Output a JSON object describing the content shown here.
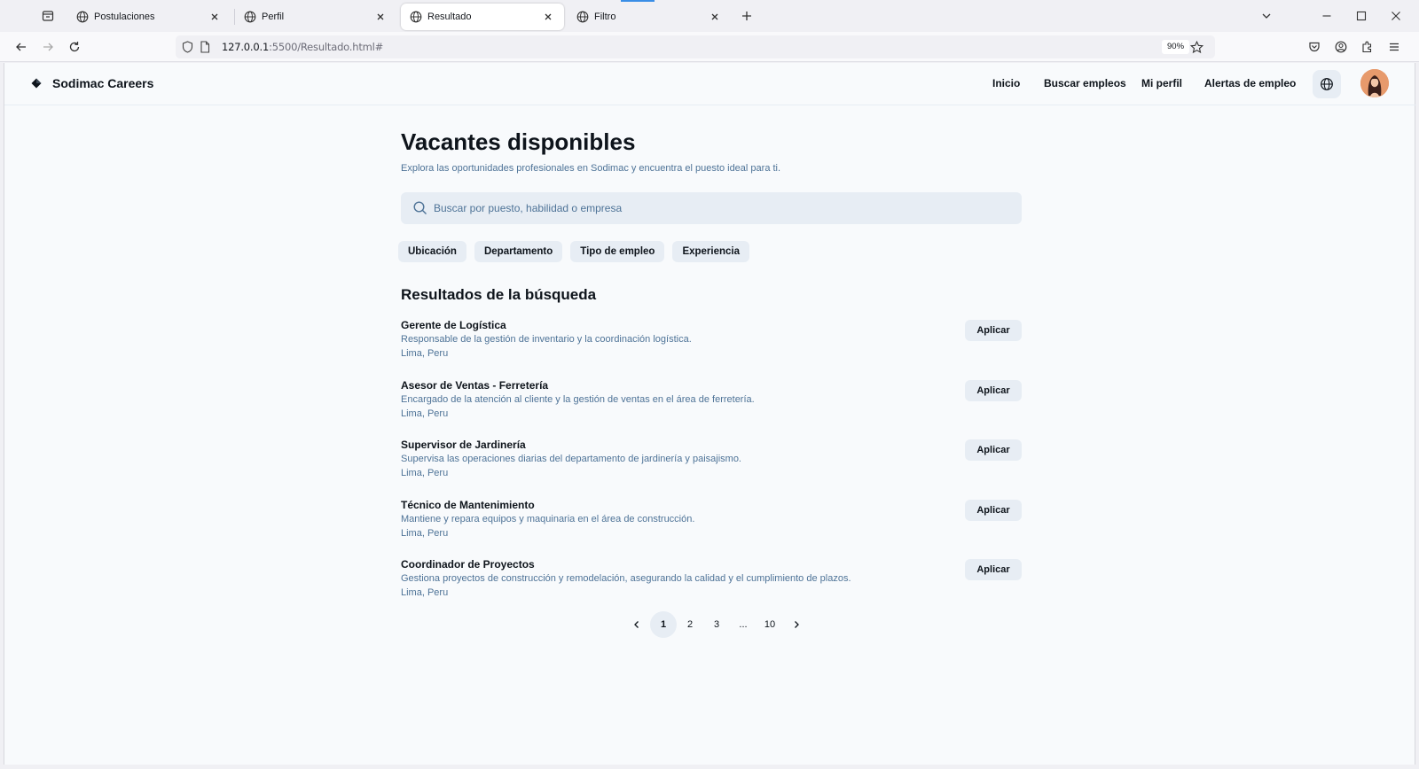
{
  "browser": {
    "tabs": [
      {
        "title": "Postulaciones",
        "active": false
      },
      {
        "title": "Perfil",
        "active": false
      },
      {
        "title": "Resultado",
        "active": true
      },
      {
        "title": "Filtro",
        "active": false
      }
    ],
    "url_host": "127.0.0.1",
    "url_rest": ":5500/Resultado.html#",
    "zoom": "90%"
  },
  "header": {
    "brand": "Sodimac Careers",
    "nav": [
      "Inicio",
      "Buscar empleos",
      "Mi perfil",
      "Alertas de empleo"
    ]
  },
  "main": {
    "title": "Vacantes disponibles",
    "subtitle": "Explora las oportunidades profesionales en Sodimac y encuentra el puesto ideal para ti.",
    "search_placeholder": "Buscar por puesto, habilidad o empresa",
    "filters": [
      "Ubicación",
      "Departamento",
      "Tipo de empleo",
      "Experiencia"
    ],
    "results_title": "Resultados de la búsqueda",
    "apply_label": "Aplicar",
    "results": [
      {
        "title": "Gerente de Logística",
        "description": "Responsable de la gestión de inventario y la coordinación logística.",
        "location": "Lima, Peru"
      },
      {
        "title": "Asesor de Ventas - Ferretería",
        "description": "Encargado de la atención al cliente y la gestión de ventas en el área de ferretería.",
        "location": "Lima, Peru"
      },
      {
        "title": "Supervisor de Jardinería",
        "description": "Supervisa las operaciones diarias del departamento de jardinería y paisajismo.",
        "location": "Lima, Peru"
      },
      {
        "title": "Técnico de Mantenimiento",
        "description": "Mantiene y repara equipos y maquinaria en el área de construcción.",
        "location": "Lima, Peru"
      },
      {
        "title": "Coordinador de Proyectos",
        "description": "Gestiona proyectos de construcción y remodelación, asegurando la calidad y el cumplimiento de plazos.",
        "location": "Lima, Peru"
      }
    ],
    "pagination": {
      "pages": [
        "1",
        "2",
        "3",
        "...",
        "10"
      ],
      "current": "1"
    }
  },
  "colors": {
    "accent_bg": "#e7edf4",
    "muted_text": "#4e7397",
    "text": "#0e141b"
  }
}
